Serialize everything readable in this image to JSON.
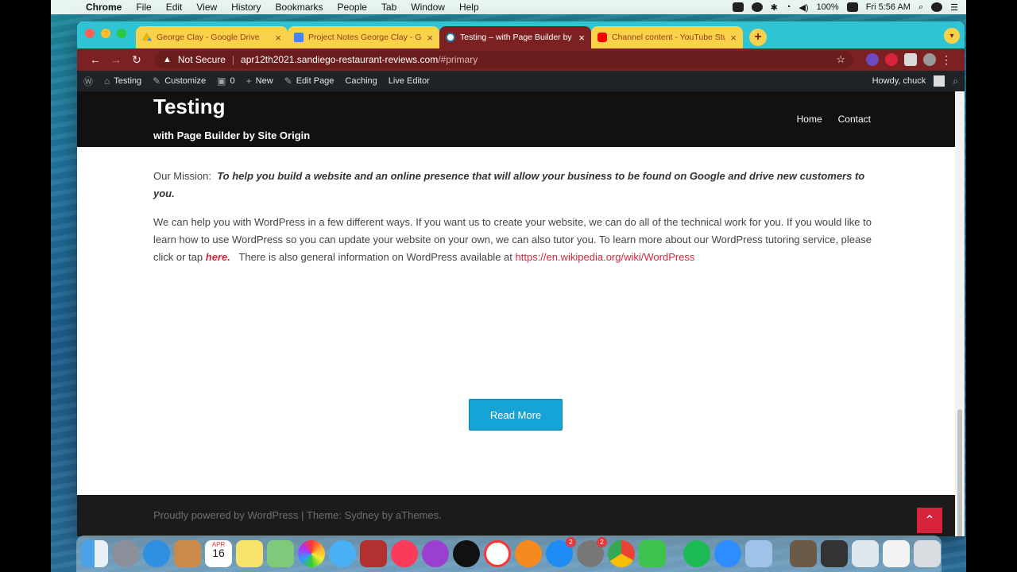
{
  "menubar": {
    "app": "Chrome",
    "items": [
      "File",
      "Edit",
      "View",
      "History",
      "Bookmarks",
      "People",
      "Tab",
      "Window",
      "Help"
    ],
    "battery": "100%",
    "clock": "Fri 5:56 AM"
  },
  "tabs": [
    {
      "title": "George Clay - Google Drive",
      "favicon": "drive"
    },
    {
      "title": "Project Notes George Clay - Go",
      "favicon": "docs"
    },
    {
      "title": "Testing – with Page Builder by S",
      "favicon": "wordpress"
    },
    {
      "title": "Channel content - YouTube Stu",
      "favicon": "youtube"
    }
  ],
  "address": {
    "security": "Not Secure",
    "host": "apr12th2021.sandiego-restaurant-reviews.com",
    "path": "/#primary"
  },
  "wp_admin_bar": {
    "site": "Testing",
    "customize": "Customize",
    "comments": "0",
    "new": "New",
    "edit": "Edit Page",
    "caching": "Caching",
    "live_editor": "Live Editor",
    "howdy": "Howdy, chuck"
  },
  "site": {
    "title": "Testing",
    "tagline": "with Page Builder by Site Origin",
    "nav": [
      "Home",
      "Contact"
    ]
  },
  "content": {
    "mission_label": "Our Mission:",
    "mission_text": "To help you build a website and an online presence that will allow your business to be found on Google and drive new customers to you.",
    "para_intro": "We can help you with WordPress in a few different ways.  If you want us to create your website, we can do all of the technical work for you.  If you would like to learn how to use WordPress so you can update your website on your own, we can also tutor you.  To learn more about our WordPress tutoring service, please click or tap",
    "here_link": "here.",
    "para_tail": "There is also general information on WordPress available at",
    "wiki_link": "https://en.wikipedia.org/wiki/WordPress",
    "read_more": "Read More"
  },
  "footer": {
    "text": "Proudly powered by WordPress | Theme: Sydney by aThemes."
  },
  "dock": {
    "icons": [
      "finder",
      "launchpad",
      "safari",
      "contacts",
      "calendar",
      "notes",
      "maps",
      "photos",
      "messages",
      "photo-booth",
      "music",
      "podcasts",
      "apple-tv",
      "news",
      "books",
      "app-store",
      "system-preferences",
      "chrome",
      "facetime",
      "spotify",
      "zoom",
      "preview",
      "photo",
      "screenshot",
      "window",
      "window2",
      "trash"
    ],
    "calendar_month": "APR",
    "calendar_day": "16",
    "app_store_badge": "2",
    "system_prefs_badge": "2"
  },
  "colors": {
    "tabstrip": "#2ec4d3",
    "toolbar": "#7b2121",
    "accent_red": "#d6243b",
    "button_blue": "#16a3d6"
  }
}
